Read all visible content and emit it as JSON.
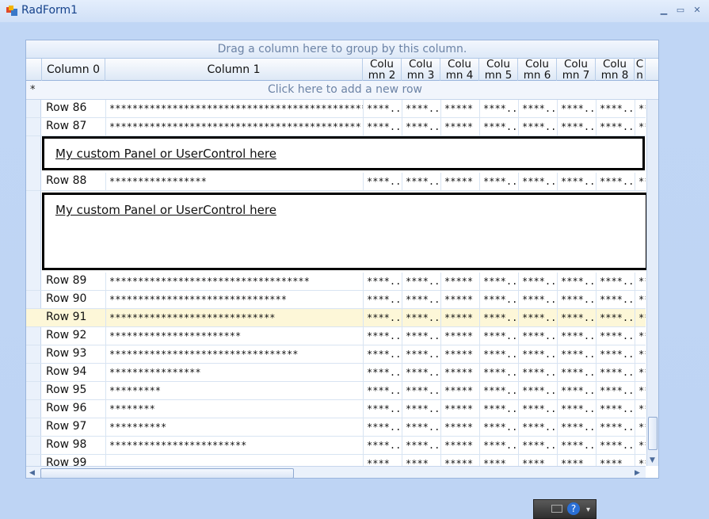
{
  "window": {
    "title": "RadForm1"
  },
  "grid": {
    "group_panel_text": "Drag a column here to group by this column.",
    "new_row_text": "Click here to add a new row",
    "new_row_marker": "*",
    "columns": [
      "Column 0",
      "Column 1",
      "Colu mn 2",
      "Colu mn 3",
      "Colu mn 4",
      "Colu mn 5",
      "Colu mn 6",
      "Colu mn 7",
      "Colu mn 8",
      "C n"
    ],
    "rows": [
      {
        "c0": "Row 86",
        "c1": "*************************************************",
        "c2": "****...",
        "c3": "****...",
        "c4": "*****",
        "c5": "****...",
        "c6": "****...",
        "c7": "****...",
        "c8": "****...",
        "c9": "**"
      },
      {
        "c0": "Row 87",
        "c1": "********************************************",
        "c2": "****...",
        "c3": "****...",
        "c4": "*****",
        "c5": "****...",
        "c6": "****...",
        "c7": "****...",
        "c8": "****...",
        "c9": "**"
      },
      {
        "c0": "Row 88",
        "c1": "*****************",
        "c2": "****...",
        "c3": "****...",
        "c4": "*****",
        "c5": "****...",
        "c6": "****...",
        "c7": "****...",
        "c8": "****...",
        "c9": "**"
      },
      {
        "c0": "Row 89",
        "c1": "***********************************",
        "c2": "****...",
        "c3": "****...",
        "c4": "*****",
        "c5": "****...",
        "c6": "****...",
        "c7": "****...",
        "c8": "****...",
        "c9": "**"
      },
      {
        "c0": "Row 90",
        "c1": "*******************************",
        "c2": "****...",
        "c3": "****...",
        "c4": "*****",
        "c5": "****...",
        "c6": "****...",
        "c7": "****...",
        "c8": "****...",
        "c9": "**"
      },
      {
        "c0": "Row 91",
        "c1": "*****************************",
        "c2": "****...",
        "c3": "****...",
        "c4": "*****",
        "c5": "****...",
        "c6": "****...",
        "c7": "****...",
        "c8": "****...",
        "c9": "**"
      },
      {
        "c0": "Row 92",
        "c1": "***********************",
        "c2": "****...",
        "c3": "****...",
        "c4": "*****",
        "c5": "****...",
        "c6": "****...",
        "c7": "****...",
        "c8": "****...",
        "c9": "**"
      },
      {
        "c0": "Row 93",
        "c1": "*********************************",
        "c2": "****...",
        "c3": "****...",
        "c4": "*****",
        "c5": "****...",
        "c6": "****...",
        "c7": "****...",
        "c8": "****...",
        "c9": "**"
      },
      {
        "c0": "Row 94",
        "c1": "****************",
        "c2": "****...",
        "c3": "****...",
        "c4": "*****",
        "c5": "****...",
        "c6": "****...",
        "c7": "****...",
        "c8": "****...",
        "c9": "**"
      },
      {
        "c0": "Row 95",
        "c1": "*********",
        "c2": "****...",
        "c3": "****...",
        "c4": "*****",
        "c5": "****...",
        "c6": "****...",
        "c7": "****...",
        "c8": "****...",
        "c9": "**"
      },
      {
        "c0": "Row 96",
        "c1": "********",
        "c2": "****...",
        "c3": "****...",
        "c4": "*****",
        "c5": "****...",
        "c6": "****...",
        "c7": "****...",
        "c8": "****...",
        "c9": "**"
      },
      {
        "c0": "Row 97",
        "c1": "**********",
        "c2": "****...",
        "c3": "****...",
        "c4": "*****",
        "c5": "****...",
        "c6": "****...",
        "c7": "****...",
        "c8": "****...",
        "c9": "**"
      },
      {
        "c0": "Row 98",
        "c1": "************************",
        "c2": "****...",
        "c3": "****...",
        "c4": "*****",
        "c5": "****...",
        "c6": "****...",
        "c7": "****...",
        "c8": "****...",
        "c9": "**"
      },
      {
        "c0": "Row 99",
        "c1": "",
        "c2": "****",
        "c3": "****",
        "c4": "*****",
        "c5": "****",
        "c6": "****",
        "c7": "****",
        "c8": "****",
        "c9": "**"
      }
    ],
    "custom_panels": [
      "My custom Panel or UserControl here",
      "My custom Panel or UserControl here"
    ]
  },
  "colors": {
    "accent": "#15428b",
    "selected_row": "#fdf7d8",
    "grid_line": "#d8e4f2"
  }
}
